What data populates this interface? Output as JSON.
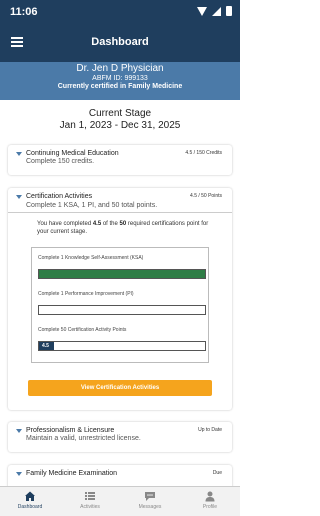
{
  "status_bar": {
    "time": "11:06"
  },
  "header": {
    "title": "Dashboard",
    "menu_icon": "hamburger-menu-icon"
  },
  "profile": {
    "name": "Dr. Jen D Physician",
    "abfm_id": "ABFM ID: 999133",
    "certification": "Currently certified in Family Medicine"
  },
  "stage": {
    "label": "Current Stage",
    "range": "Jan 1, 2023 - Dec 31, 2025"
  },
  "cards": {
    "cme": {
      "title": "Continuing Medical Education",
      "right": "4.5 / 150 Credits",
      "desc": "Complete 150 credits."
    },
    "certification": {
      "title": "Certification Activities",
      "right": "4.5 / 50 Points",
      "desc": "Complete 1 KSA, 1 PI, and 50 total points.",
      "summary_pre": "You have completed ",
      "summary_completed": "4.5",
      "summary_mid": " of the ",
      "summary_required": "50",
      "summary_post": " required certifications point for your current stage.",
      "requirements": [
        {
          "label": "Complete 1 Knowledge Self-Assessment (KSA)",
          "progress": 1.0,
          "value_text": ""
        },
        {
          "label": "Complete 1 Performance Improvement (PI)",
          "progress": 0.0,
          "value_text": ""
        },
        {
          "label": "Complete 50 Certification Activity Points",
          "progress": 0.09,
          "value_text": "4.5"
        }
      ],
      "button": "View Certification Activities"
    },
    "licensure": {
      "title": "Professionalism & Licensure",
      "right": "Up to Date",
      "desc": "Maintain a valid, unrestricted license."
    },
    "exam": {
      "title": "Family Medicine Examination",
      "right": "Due",
      "desc": ""
    }
  },
  "nav": [
    {
      "label": "Dashboard",
      "icon": "home-icon",
      "active": true
    },
    {
      "label": "Activities",
      "icon": "list-icon",
      "active": false
    },
    {
      "label": "Messages",
      "icon": "chat-icon",
      "active": false
    },
    {
      "label": "Profile",
      "icon": "person-icon",
      "active": false
    }
  ],
  "colors": {
    "header": "#1f3e5e",
    "profile_band": "#4b7aa8",
    "progress_green": "#2f7d46",
    "button_orange": "#f5a41d"
  }
}
